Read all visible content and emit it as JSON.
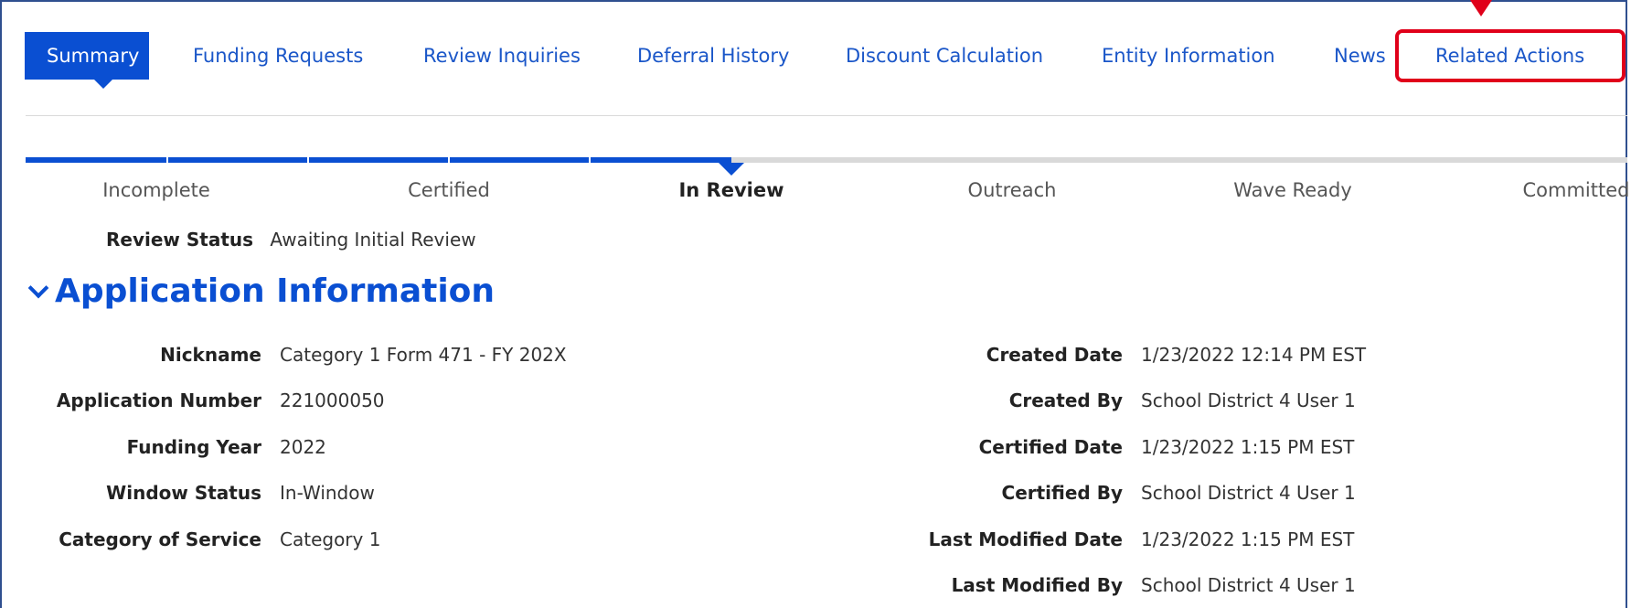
{
  "tabs": [
    {
      "label": "Summary",
      "active": true
    },
    {
      "label": "Funding Requests",
      "active": false
    },
    {
      "label": "Review Inquiries",
      "active": false
    },
    {
      "label": "Deferral History",
      "active": false
    },
    {
      "label": "Discount Calculation",
      "active": false
    },
    {
      "label": "Entity Information",
      "active": false
    },
    {
      "label": "News",
      "active": false
    },
    {
      "label": "Related Actions",
      "active": false
    }
  ],
  "progress": {
    "steps": [
      "Incomplete",
      "Certified",
      "In Review",
      "Outreach",
      "Wave Ready",
      "Committed"
    ],
    "current": "In Review"
  },
  "review_status": {
    "label": "Review Status",
    "value": "Awaiting Initial Review"
  },
  "section": {
    "title": "Application Information"
  },
  "left_fields": [
    {
      "label": "Nickname",
      "value": "Category 1 Form 471 - FY 202X"
    },
    {
      "label": "Application Number",
      "value": "221000050"
    },
    {
      "label": "Funding Year",
      "value": "2022"
    },
    {
      "label": "Window Status",
      "value": "In-Window"
    },
    {
      "label": "Category of Service",
      "value": "Category 1"
    }
  ],
  "right_fields": [
    {
      "label": "Created Date",
      "value": "1/23/2022 12:14 PM EST"
    },
    {
      "label": "Created By",
      "value": "School District 4 User 1"
    },
    {
      "label": "Certified Date",
      "value": "1/23/2022 1:15 PM EST"
    },
    {
      "label": "Certified By",
      "value": "School District 4 User 1"
    },
    {
      "label": "Last Modified Date",
      "value": "1/23/2022 1:15 PM EST"
    },
    {
      "label": "Last Modified By",
      "value": "School District 4 User 1"
    }
  ],
  "colors": {
    "accent": "#0a4fd2",
    "highlight": "#e0001a"
  }
}
